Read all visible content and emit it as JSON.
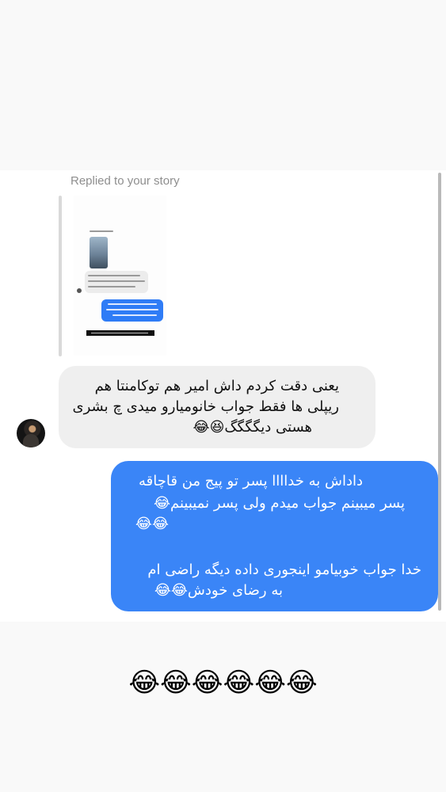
{
  "story_reply": {
    "label": "Replied to your story"
  },
  "incoming_message": {
    "lines": [
      "یعنی دقت کردم داش امیر هم توکامنتا هم",
      "ریپلی ها فقط جواب خانومیارو میدی چ بشری",
      "هستی دیگگگگ😆😂"
    ]
  },
  "outgoing_message": {
    "lines": [
      "داداش به خداااا پسر تو پیج من قاچاقه",
      "پسر میبینم جواب میدم ولی پسر نمیبینم😂",
      "😂😂",
      "خدا جواب خوبیامو اینجوری داده دیگه راضی ام",
      "به رضای خودش😂😂"
    ]
  },
  "caption": {
    "text": "😂😂😂😂😂😂"
  },
  "colors": {
    "outgoing_bubble": "#3a85f7",
    "incoming_bubble": "#efefef",
    "label_grey": "#8e8e8e"
  }
}
